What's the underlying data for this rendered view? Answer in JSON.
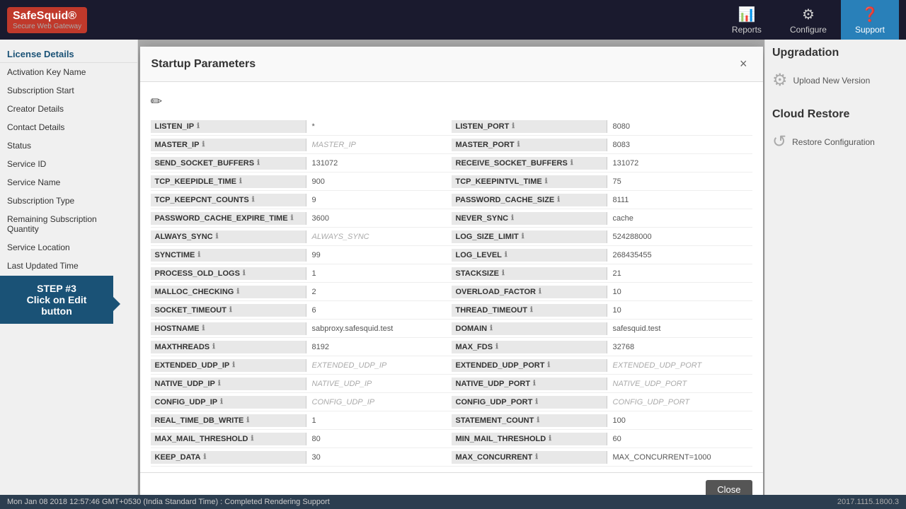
{
  "header": {
    "logo_text": "SafeSquid®",
    "logo_sub": "Secure Web Gateway",
    "nav_items": [
      {
        "id": "reports",
        "label": "Reports",
        "icon": "📊"
      },
      {
        "id": "configure",
        "label": "Configure",
        "icon": "⚙"
      },
      {
        "id": "support",
        "label": "Support",
        "icon": "❓",
        "active": true
      }
    ]
  },
  "sidebar": {
    "section_title": "License Details",
    "items": [
      {
        "label": "Activation Key Name"
      },
      {
        "label": "Subscription Start"
      },
      {
        "label": "Creator Details"
      },
      {
        "label": "Contact Details"
      },
      {
        "label": "Status"
      },
      {
        "label": "Service ID"
      },
      {
        "label": "Service Name"
      },
      {
        "label": "Subscription Type"
      },
      {
        "label": "Remaining Subscription Quantity"
      },
      {
        "label": "Service Location"
      },
      {
        "label": "Last Updated Time"
      }
    ]
  },
  "right_panel": {
    "upgradation_title": "Upgradation",
    "upload_label": "Upload New Version",
    "cloud_restore_title": "Cloud Restore",
    "restore_label": "Restore Configuration"
  },
  "modal": {
    "title": "Startup Parameters",
    "close_label": "×",
    "bottom_close_label": "Close",
    "edit_icon": "✏",
    "left_params": [
      {
        "name": "LISTEN_IP",
        "value": "*",
        "placeholder": false
      },
      {
        "name": "MASTER_IP",
        "value": "MASTER_IP",
        "placeholder": true
      },
      {
        "name": "SEND_SOCKET_BUFFERS",
        "value": "131072",
        "placeholder": false
      },
      {
        "name": "TCP_KEEPIDLE_TIME",
        "value": "900",
        "placeholder": false
      },
      {
        "name": "TCP_KEEPCNT_COUNTS",
        "value": "9",
        "placeholder": false
      },
      {
        "name": "PASSWORD_CACHE_EXPIRE_TIME",
        "value": "3600",
        "placeholder": false
      },
      {
        "name": "ALWAYS_SYNC",
        "value": "ALWAYS_SYNC",
        "placeholder": true
      },
      {
        "name": "SYNCTIME",
        "value": "99",
        "placeholder": false
      },
      {
        "name": "PROCESS_OLD_LOGS",
        "value": "1",
        "placeholder": false
      },
      {
        "name": "MALLOC_CHECKING",
        "value": "2",
        "placeholder": false
      },
      {
        "name": "SOCKET_TIMEOUT",
        "value": "6",
        "placeholder": false
      },
      {
        "name": "HOSTNAME",
        "value": "sabproxy.safesquid.test",
        "placeholder": false
      },
      {
        "name": "MAXTHREADS",
        "value": "8192",
        "placeholder": false
      },
      {
        "name": "EXTENDED_UDP_IP",
        "value": "EXTENDED_UDP_IP",
        "placeholder": true
      },
      {
        "name": "NATIVE_UDP_IP",
        "value": "NATIVE_UDP_IP",
        "placeholder": true
      },
      {
        "name": "CONFIG_UDP_IP",
        "value": "CONFIG_UDP_IP",
        "placeholder": true
      },
      {
        "name": "REAL_TIME_DB_WRITE",
        "value": "1",
        "placeholder": false
      },
      {
        "name": "MAX_MAIL_THRESHOLD",
        "value": "80",
        "placeholder": false
      },
      {
        "name": "KEEP_DATA",
        "value": "30",
        "placeholder": false
      }
    ],
    "right_params": [
      {
        "name": "LISTEN_PORT",
        "value": "8080",
        "placeholder": false
      },
      {
        "name": "MASTER_PORT",
        "value": "8083",
        "placeholder": false
      },
      {
        "name": "RECEIVE_SOCKET_BUFFERS",
        "value": "131072",
        "placeholder": false
      },
      {
        "name": "TCP_KEEPINTVL_TIME",
        "value": "75",
        "placeholder": false
      },
      {
        "name": "PASSWORD_CACHE_SIZE",
        "value": "8111",
        "placeholder": false
      },
      {
        "name": "NEVER_SYNC",
        "value": "cache",
        "placeholder": false
      },
      {
        "name": "LOG_SIZE_LIMIT",
        "value": "524288000",
        "placeholder": false
      },
      {
        "name": "LOG_LEVEL",
        "value": "268435455",
        "placeholder": false
      },
      {
        "name": "STACKSIZE",
        "value": "21",
        "placeholder": false
      },
      {
        "name": "OVERLOAD_FACTOR",
        "value": "10",
        "placeholder": false
      },
      {
        "name": "THREAD_TIMEOUT",
        "value": "10",
        "placeholder": false
      },
      {
        "name": "DOMAIN",
        "value": "safesquid.test",
        "placeholder": false
      },
      {
        "name": "MAX_FDS",
        "value": "32768",
        "placeholder": false
      },
      {
        "name": "EXTENDED_UDP_PORT",
        "value": "EXTENDED_UDP_PORT",
        "placeholder": true
      },
      {
        "name": "NATIVE_UDP_PORT",
        "value": "NATIVE_UDP_PORT",
        "placeholder": true
      },
      {
        "name": "CONFIG_UDP_PORT",
        "value": "CONFIG_UDP_PORT",
        "placeholder": true
      },
      {
        "name": "STATEMENT_COUNT",
        "value": "100",
        "placeholder": false
      },
      {
        "name": "MIN_MAIL_THRESHOLD",
        "value": "60",
        "placeholder": false
      },
      {
        "name": "MAX_CONCURRENT",
        "value": "MAX_CONCURRENT=1000",
        "placeholder": false
      }
    ]
  },
  "step_tooltip": {
    "step": "STEP #3",
    "action": "Click on Edit",
    "object": "button"
  },
  "status_bar": {
    "message": "Mon Jan 08 2018 12:57:46 GMT+0530 (India Standard Time) : Completed Rendering Support",
    "version": "2017.1115.1800.3"
  }
}
